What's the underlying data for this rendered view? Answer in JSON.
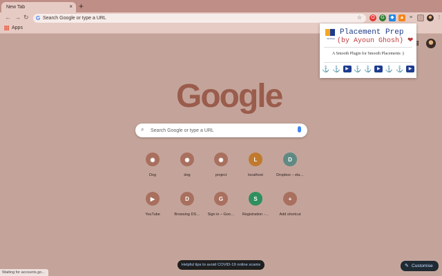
{
  "browser": {
    "tab_title": "New Tab",
    "tab_close": "×",
    "new_tab": "+",
    "omnibox_placeholder": "Search Google or type a URL",
    "bookmarks": {
      "apps_label": "Apps"
    }
  },
  "ntp": {
    "logo": "Google",
    "search_placeholder": "Search Google or type a URL",
    "shortcuts": [
      {
        "label": "Dog",
        "glyph": "◉",
        "bg": "#a9705f"
      },
      {
        "label": "dog",
        "glyph": "◉",
        "bg": "#a9705f"
      },
      {
        "label": "project",
        "glyph": "◉",
        "bg": "#a9705f"
      },
      {
        "label": "localhost",
        "glyph": "L",
        "bg": "#c07a2e"
      },
      {
        "label": "Dropbox – ela…",
        "glyph": "D",
        "bg": "#5f8a83"
      },
      {
        "label": "YouTube",
        "glyph": "▶",
        "bg": "#a9705f"
      },
      {
        "label": "Browsing DS…",
        "glyph": "D",
        "bg": "#a9705f"
      },
      {
        "label": "Sign in – Goo…",
        "glyph": "G",
        "bg": "#a9705f"
      },
      {
        "label": "Registration -…",
        "glyph": "S",
        "bg": "#2f8f5f"
      },
      {
        "label": "Add shortcut",
        "glyph": "+",
        "bg": "#a9705f"
      }
    ],
    "tips": "Helpful tips to avoid COVID-19 online scams",
    "customise": "Customise"
  },
  "popup": {
    "logo_caption": "Ski Rissai",
    "title": "Placement Prep",
    "subtitle": "(by Ayoun Ghosh) ❤",
    "tagline": "A Smooth Plugin for Smooth Placements :)",
    "icons": [
      "anchor-icon",
      "anchor-icon",
      "youtube-icon",
      "anchor-icon",
      "anchor-icon",
      "youtube-icon",
      "anchor-icon",
      "anchor-icon",
      "youtube-icon"
    ]
  },
  "status_text": "Waiting for accounts.go..."
}
